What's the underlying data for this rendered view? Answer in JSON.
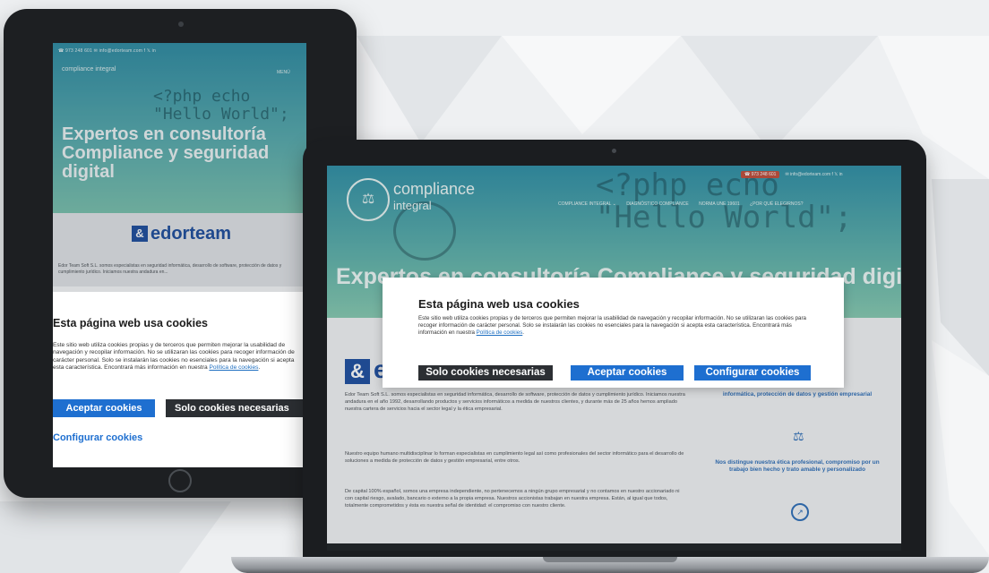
{
  "tablet": {
    "topbar": "☎ 973 248 601   ✉ info@edorteam.com   f  𝕏  in",
    "logo": "compliance integral",
    "menu": "MENÚ",
    "code": "<?php echo\n\"Hello World\";",
    "hero": "Expertos en consultoría Compliance y seguridad digital",
    "brand_badge": "&",
    "brand": "edorteam",
    "intro": "Edor Team Soft S.L. somos especialistas en seguridad informática, desarrollo de software, protección de datos y cumplimiento jurídico. Iniciamos nuestra andadura en...",
    "cookie_title": "Esta página web usa cookies",
    "cookie_text": "Este sitio web utiliza cookies propias y de terceros que permiten mejorar la usabilidad de navegación y recopilar información. No se utilizaran las cookies para recoger información de carácter personal. Solo se instalarán las cookies no esenciales para la navegación si acepta esta característica. Encontrará más información en nuestra ",
    "cookie_link": "Política de cookies",
    "accept": "Aceptar cookies",
    "solo": "Solo cookies necesarias",
    "config": "Configurar cookies"
  },
  "laptop": {
    "phone": "☎ 973 248 601",
    "email": "✉ info@edorteam.com   f  𝕏  in",
    "logo_line1": "compliance",
    "logo_line2": "integral",
    "nav": [
      "COMPLIANCE INTEGRAL ⌄",
      "DIAGNÓSTICO COMPLIANCE",
      "NORMA UNE 19601",
      "¿POR QUÉ ELEGIRNOS?"
    ],
    "code": "<?php echo\n\"Hello World\";",
    "headline": "Expertos en consultoría Compliance y seguridad digital",
    "brand_e": "e",
    "p1": "Edor Team Soft S.L. somos especialistas en seguridad informática, desarrollo de software, protección de datos y cumplimiento jurídico. Iniciamos nuestra andadura en el año 1992, desarrollando productos y servicios informáticos a medida de nuestros clientes, y durante más de 25 años hemos ampliado nuestra cartera de servicios hacia el sector legal y la ética empresarial.",
    "p2": "Nuestro equipo humano multidisciplinar lo forman especialistas en cumplimiento legal así como profesionales del sector informático para el desarrollo de soluciones a medida de protección de datos y gestión empresarial, entre otros.",
    "p3": "De capital 100% español, somos una empresa independiente, no pertenecemos a ningún grupo empresarial y no contamos en nuestro accionariado ni con capital riesgo, avalado, bancario o externo a la propia empresa. Nuestros accionistas trabajan en nuestra empresa. Están, al igual que todos, totalmente comprometidos y ésta es nuestra señal de identidad: el compromiso con nuestro cliente.",
    "side1": "informática, protección de datos y gestión empresarial",
    "side2": "Nos distingue nuestra ética profesional, compromiso por un trabajo bien hecho y trato amable y personalizado",
    "scale_icon": "⚖",
    "compass_icon": "↗",
    "cookie_title": "Esta página web usa cookies",
    "cookie_text": "Este sitio web utiliza cookies propias y de terceros que permiten mejorar la usabilidad de navegación y recopilar información. No se utilizaran las cookies para recoger información de carácter personal. Solo se instalarán las cookies no esenciales para la navegación si acepta esta característica. Encontrará más información en nuestra ",
    "cookie_link": "Política de cookies",
    "solo": "Solo cookies necesarias",
    "accept": "Aceptar cookies",
    "config": "Configurar cookies"
  },
  "colors": {
    "primary_blue": "#1e6fd0",
    "dark_button": "#2c2f33",
    "brand_blue": "#1e4fa0",
    "hero_teal": "#2f8fa6"
  }
}
